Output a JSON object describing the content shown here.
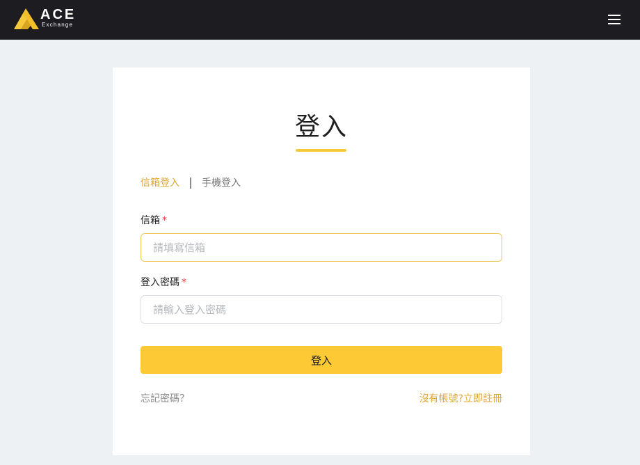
{
  "header": {
    "logo_text": "ACE",
    "logo_subtext": "Exchange",
    "brand_color": "#f6c93a",
    "menu_icon": "hamburger-menu-icon"
  },
  "login": {
    "title": "登入",
    "tabs": [
      {
        "label": "信箱登入",
        "active": true
      },
      {
        "label": "手機登入",
        "active": false
      }
    ],
    "email": {
      "label": "信箱",
      "required_mark": "*",
      "placeholder": "請填寫信箱",
      "value": ""
    },
    "password": {
      "label": "登入密碼",
      "required_mark": "*",
      "placeholder": "請輸入登入密碼",
      "value": ""
    },
    "submit_label": "登入",
    "forgot_password": "忘記密碼？",
    "register_link": "沒有帳號?立即註冊"
  },
  "colors": {
    "accent": "#e1a732",
    "button": "#fdc934",
    "header_bg": "#1c1c21",
    "page_bg": "#edf1f4"
  }
}
